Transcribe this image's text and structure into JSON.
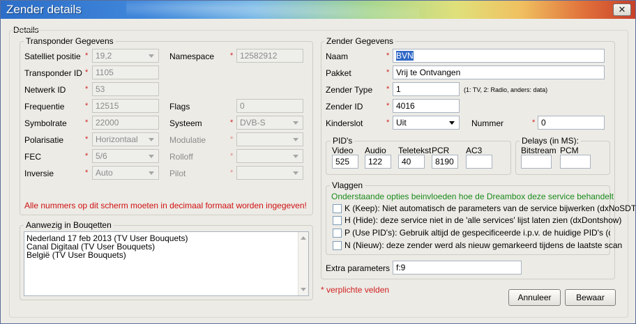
{
  "window": {
    "title": "Zender details",
    "close_glyph": "✕"
  },
  "details_label": "Details",
  "transponder": {
    "legend": "Transponder Gegevens",
    "satelliet_label": "Satelliet positie",
    "satelliet_value": "19,2",
    "transponder_id_label": "Transponder ID",
    "transponder_id_value": "1105",
    "netwerk_id_label": "Netwerk ID",
    "netwerk_id_value": "53",
    "frequentie_label": "Frequentie",
    "frequentie_value": "12515",
    "symbolrate_label": "Symbolrate",
    "symbolrate_value": "22000",
    "polarisatie_label": "Polarisatie",
    "polarisatie_value": "Horizontaal",
    "fec_label": "FEC",
    "fec_value": "5/6",
    "inversie_label": "Inversie",
    "inversie_value": "Auto",
    "namespace_label": "Namespace",
    "namespace_value": "12582912",
    "flags_label": "Flags",
    "flags_value": "0",
    "systeem_label": "Systeem",
    "systeem_value": "DVB-S",
    "modulatie_label": "Modulatie",
    "modulatie_value": "",
    "rolloff_label": "Rolloff",
    "rolloff_value": "",
    "pilot_label": "Pilot",
    "pilot_value": "",
    "warning": "Alle nummers op dit scherm moeten in decimaal formaat worden ingegeven!"
  },
  "bouquets": {
    "legend": "Aanwezig in Bouqetten",
    "items": [
      "Nederland 17 feb 2013 (TV User Bouquets)",
      "Canal Digitaal (TV User Bouquets)",
      "België (TV User Bouquets)"
    ]
  },
  "zender": {
    "legend": "Zender Gegevens",
    "naam_label": "Naam",
    "naam_value": "BVN",
    "pakket_label": "Pakket",
    "pakket_value": "Vrij te Ontvangen",
    "type_label": "Zender Type",
    "type_value": "1",
    "type_hint": "(1: TV, 2: Radio, anders: data)",
    "id_label": "Zender ID",
    "id_value": "4016",
    "kinderslot_label": "Kinderslot",
    "kinderslot_value": "Uit",
    "nummer_label": "Nummer",
    "nummer_value": "0"
  },
  "pids": {
    "legend": "PID's",
    "video_label": "Video",
    "video_value": "525",
    "audio_label": "Audio",
    "audio_value": "122",
    "teletekst_label": "Teletekst",
    "teletekst_value": "40",
    "pcr_label": "PCR",
    "pcr_value": "8190",
    "ac3_label": "AC3",
    "ac3_value": ""
  },
  "delays": {
    "legend": "Delays (in MS):",
    "bitstream_label": "Bitstream",
    "bitstream_value": "",
    "pcm_label": "PCM",
    "pcm_value": ""
  },
  "vlaggen": {
    "legend": "Vlaggen",
    "intro": "Onderstaande opties beinvloeden hoe de Dreambox deze service behandelt",
    "intro_color": "#1a8a1a",
    "options": [
      "K (Keep): Niet automatisch de parameters van de service bijwerken (dxNoSDT)",
      "H (Hide): deze service niet in de 'alle services' lijst laten zien (dxDontshow)",
      "P (Use PID's): Gebruik altijd de gespecificeerde i.p.v. de huidige PID's (dxNoDVB",
      "N (Nieuw): deze zender werd als nieuw gemarkeerd tijdens de laatste scan"
    ]
  },
  "extra": {
    "label": "Extra parameters",
    "value": "f:9"
  },
  "footer": {
    "required_note": "* verplichte velden",
    "cancel_label": "Annuleer",
    "save_label": "Bewaar"
  },
  "required_mark": "*",
  "colors": {
    "required": "#d02020",
    "warning": "#d01010",
    "selection": "#3169c6"
  }
}
